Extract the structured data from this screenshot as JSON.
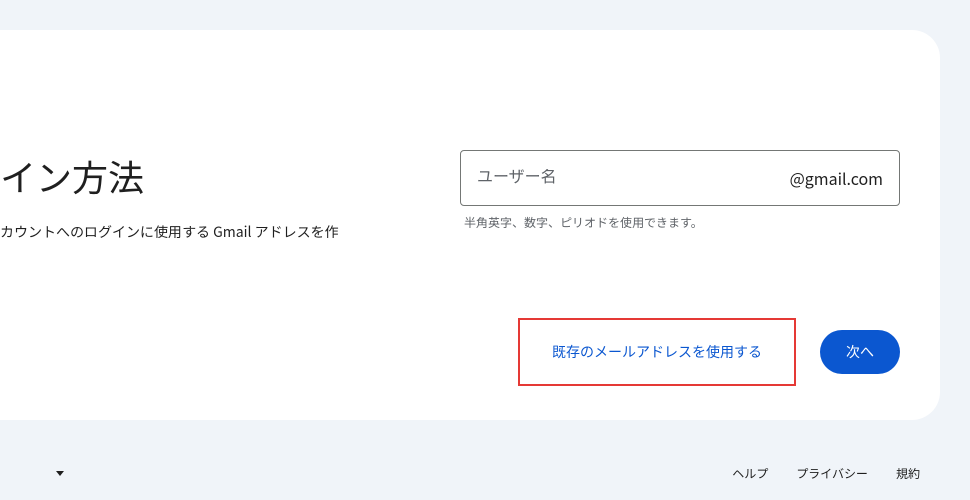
{
  "heading": "イン方法",
  "subtext": "カウントへのログインに使用する Gmail アドレスを作",
  "input": {
    "placeholder": "ユーザー名",
    "suffix": "@gmail.com"
  },
  "helper": "半角英字、数字、ピリオドを使用できます。",
  "actions": {
    "use_existing": "既存のメールアドレスを使用する",
    "next": "次へ"
  },
  "footer": {
    "links": {
      "help": "ヘルプ",
      "privacy": "プライバシー",
      "terms": "規約"
    }
  }
}
